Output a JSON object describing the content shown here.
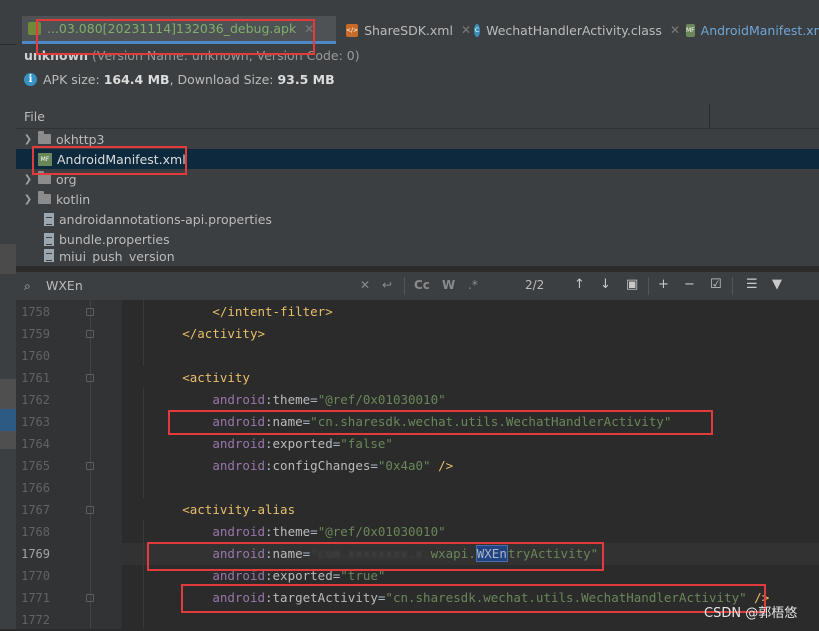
{
  "tabs": [
    {
      "label": "...03.080[20231114]132036_debug.apk",
      "icon": "apk-icon",
      "active": true
    },
    {
      "label": "ShareSDK.xml",
      "icon": "xml-icon",
      "active": false
    },
    {
      "label": "WechatHandlerActivity.class",
      "icon": "class-icon",
      "active": false
    },
    {
      "label": "AndroidManifest.xml",
      "icon": "manifest-icon",
      "active": false
    }
  ],
  "apk_info": {
    "app_name": "unknown",
    "version_text": "(Version Name: unknown, Version Code: 0)",
    "apk_size_label": "APK size:",
    "apk_size": "164.4 MB",
    "download_size_label": "Download Size:",
    "download_size": "93.5 MB"
  },
  "file_tree": {
    "header": "File",
    "items": [
      {
        "name": "okhttp3",
        "type": "folder"
      },
      {
        "name": "AndroidManifest.xml",
        "type": "manifest",
        "selected": true
      },
      {
        "name": "org",
        "type": "folder"
      },
      {
        "name": "kotlin",
        "type": "folder"
      },
      {
        "name": "androidannotations-api.properties",
        "type": "properties"
      },
      {
        "name": "bundle.properties",
        "type": "properties"
      },
      {
        "name": "miui_push_version",
        "type": "properties"
      }
    ]
  },
  "search": {
    "query": "WXEn",
    "match_count": "2/2",
    "case_label": "Cc",
    "word_label": "W",
    "regex_label": ".*"
  },
  "editor": {
    "lines": [
      {
        "num": "1758",
        "code": [
          [
            "",
            "            "
          ],
          [
            "tag",
            "</intent-filter>"
          ]
        ]
      },
      {
        "num": "1759",
        "code": [
          [
            "",
            "        "
          ],
          [
            "tag",
            "</activity>"
          ]
        ]
      },
      {
        "num": "1760",
        "code": []
      },
      {
        "num": "1761",
        "code": [
          [
            "",
            "        "
          ],
          [
            "tag",
            "<activity"
          ]
        ]
      },
      {
        "num": "1762",
        "code": [
          [
            "",
            "            "
          ],
          [
            "ns",
            "android"
          ],
          [
            "",
            ":"
          ],
          [
            "attr",
            "theme"
          ],
          [
            "",
            "="
          ],
          [
            "val",
            "\"@ref/0x01030010\""
          ]
        ]
      },
      {
        "num": "1763",
        "code": [
          [
            "",
            "            "
          ],
          [
            "ns",
            "android"
          ],
          [
            "",
            ":"
          ],
          [
            "attr",
            "name"
          ],
          [
            "",
            "="
          ],
          [
            "val",
            "\"cn.sharesdk.wechat.utils.WechatHandlerActivity\""
          ]
        ]
      },
      {
        "num": "1764",
        "code": [
          [
            "",
            "            "
          ],
          [
            "ns",
            "android"
          ],
          [
            "",
            ":"
          ],
          [
            "attr",
            "exported"
          ],
          [
            "",
            "="
          ],
          [
            "val",
            "\"false\""
          ]
        ]
      },
      {
        "num": "1765",
        "code": [
          [
            "",
            "            "
          ],
          [
            "ns",
            "android"
          ],
          [
            "",
            ":"
          ],
          [
            "attr",
            "configChanges"
          ],
          [
            "",
            "="
          ],
          [
            "val",
            "\"0x4a0\""
          ],
          [
            "tag",
            " />"
          ]
        ]
      },
      {
        "num": "1766",
        "code": []
      },
      {
        "num": "1767",
        "code": [
          [
            "",
            "        "
          ],
          [
            "tag",
            "<activity-alias"
          ]
        ]
      },
      {
        "num": "1768",
        "code": [
          [
            "",
            "            "
          ],
          [
            "ns",
            "android"
          ],
          [
            "",
            ":"
          ],
          [
            "attr",
            "theme"
          ],
          [
            "",
            "="
          ],
          [
            "val",
            "\"@ref/0x01030010\""
          ]
        ]
      },
      {
        "num": "1769",
        "code": [
          [
            "",
            "            "
          ],
          [
            "ns",
            "android"
          ],
          [
            "",
            ":"
          ],
          [
            "attr",
            "name"
          ],
          [
            "",
            "="
          ],
          [
            "blurred",
            "\"com.xxxxxxxx.x."
          ],
          [
            "val",
            "wxapi."
          ],
          [
            "hl",
            "WXEn"
          ],
          [
            "val",
            "tryActivity\""
          ]
        ],
        "current": true
      },
      {
        "num": "1770",
        "code": [
          [
            "",
            "            "
          ],
          [
            "ns",
            "android"
          ],
          [
            "",
            ":"
          ],
          [
            "attr",
            "exported"
          ],
          [
            "",
            "="
          ],
          [
            "val",
            "\"true\""
          ]
        ]
      },
      {
        "num": "1771",
        "code": [
          [
            "",
            "            "
          ],
          [
            "ns",
            "android"
          ],
          [
            "",
            ":"
          ],
          [
            "attr",
            "targetActivity"
          ],
          [
            "",
            "="
          ],
          [
            "val",
            "\"cn.sharesdk.wechat.utils.WechatHandlerActivity\""
          ],
          [
            "tag",
            " />"
          ]
        ]
      },
      {
        "num": "1772",
        "code": []
      }
    ]
  },
  "watermark": "CSDN @郭梧悠",
  "colors": {
    "highlight_box": "#e33b3b",
    "editor_bg": "#2b2b2b",
    "panel_bg": "#3c3f41",
    "selection": "#0d293e"
  }
}
